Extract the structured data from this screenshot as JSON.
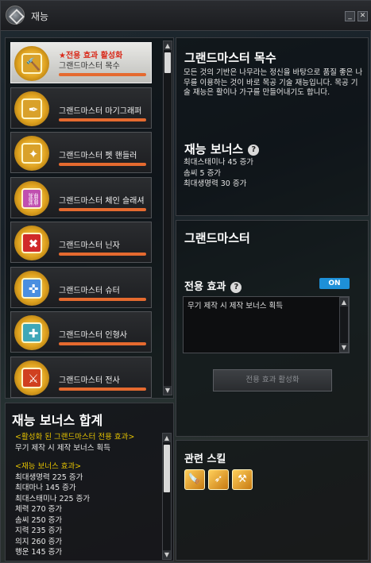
{
  "window": {
    "title": "재능",
    "minimize_symbol": "_",
    "close_symbol": "✕"
  },
  "skill_list": [
    {
      "badge": "★전용 효과 활성화",
      "name": "그랜드마스터 목수",
      "icon": "anvil-icon",
      "glyph": "🔨",
      "icon_bg": "#d9a12a",
      "selected": true
    },
    {
      "badge": "",
      "name": "그랜드마스터 마기그래퍼",
      "icon": "quill-icon",
      "glyph": "✒",
      "icon_bg": "#d9a12a",
      "selected": false
    },
    {
      "badge": "",
      "name": "그랜드마스터 펫 핸들러",
      "icon": "pet-icon",
      "glyph": "✦",
      "icon_bg": "#d9a12a",
      "selected": false
    },
    {
      "badge": "",
      "name": "그랜드마스터 체인 슬래셔",
      "icon": "chain-icon",
      "glyph": "⛓",
      "icon_bg": "#c04fb0",
      "selected": false
    },
    {
      "badge": "",
      "name": "그랜드마스터 닌자",
      "icon": "shuriken-icon",
      "glyph": "✖",
      "icon_bg": "#d02a2a",
      "selected": false
    },
    {
      "badge": "",
      "name": "그랜드마스터 슈터",
      "icon": "guns-icon",
      "glyph": "✜",
      "icon_bg": "#4a8fe0",
      "selected": false
    },
    {
      "badge": "",
      "name": "그랜드마스터 인형사",
      "icon": "puppet-icon",
      "glyph": "✚",
      "icon_bg": "#3fa7b8",
      "selected": false
    },
    {
      "badge": "",
      "name": "그랜드마스터 전사",
      "icon": "sword-icon",
      "glyph": "⚔",
      "icon_bg": "#d04020",
      "selected": false
    }
  ],
  "bonus_total": {
    "title": "재능 보너스 합계",
    "active_header": "<활성화 된 그랜드마스터 전용 효과>",
    "active_line": "무기 제작 시 제작 보너스 획득",
    "bonus_header": "<재능 보너스 효과>",
    "lines": [
      "최대생명력 225 증가",
      "최대마나 145 증가",
      "최대스태미나 225 증가",
      "체력 270 증가",
      "솜씨 250 증가",
      "지력 235 증가",
      "의지 260 증가",
      "행운 145 증가"
    ]
  },
  "detail": {
    "title": "그랜드마스터 목수",
    "description": "모든 것의 기반은 나무라는 정신을 바탕으로 품질 좋은 나무를 이용하는 것이 바로 목공 기술 재능입니다. 목공 기술 재능은 활이나 가구를 만들어내기도 합니다.",
    "bonus_title": "재능 보너스",
    "bonus_lines": [
      "최대스태미나 45 증가",
      "솜씨 5 증가",
      "최대생명력 30 증가"
    ]
  },
  "grandmaster": {
    "title": "그랜드마스터",
    "effect_label": "전용 효과",
    "toggle_label": "ON",
    "effect_text": "무기 제작 시 제작 보너스 획득",
    "activate_button": "전용 효과 활성화"
  },
  "related": {
    "title": "관련 스킬",
    "icons": [
      {
        "name": "carpentry-skill-icon",
        "glyph": "🪚"
      },
      {
        "name": "bow-craft-skill-icon",
        "glyph": "➶"
      },
      {
        "name": "lumber-skill-icon",
        "glyph": "⚒"
      }
    ]
  }
}
